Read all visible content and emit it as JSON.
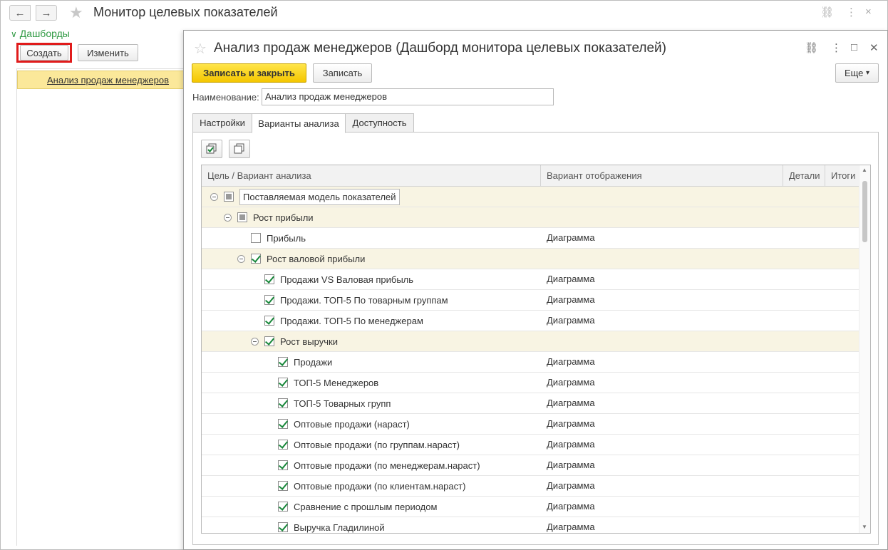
{
  "main": {
    "title": "Монитор целевых показателей",
    "back_icon": "←",
    "forward_icon": "→",
    "star_icon": "★",
    "link_icon": "⛓",
    "more_icon": "⋮",
    "close_icon": "×",
    "section_title": "Дашборды",
    "section_chevron": "∨",
    "create_label": "Создать",
    "edit_label": "Изменить",
    "list_items": [
      "Анализ продаж менеджеров"
    ]
  },
  "dialog": {
    "title": "Анализ продаж менеджеров (Дашборд монитора целевых показателей)",
    "star_icon": "☆",
    "link_icon": "⛓",
    "more_icon": "⋮",
    "maximize_icon": "□",
    "close_icon": "✕",
    "save_close_label": "Записать и закрыть",
    "save_label": "Записать",
    "more_label": "Еще",
    "more_arrow": "▾",
    "name_label": "Наименование:",
    "name_value": "Анализ продаж менеджеров",
    "tabs": [
      "Настройки",
      "Варианты анализа",
      "Доступность"
    ],
    "active_tab": 1,
    "columns": [
      "Цель / Вариант анализа",
      "Вариант отображения",
      "Детали",
      "Итоги"
    ],
    "rows": [
      {
        "name": "Поставляемая модель показателей",
        "view": "",
        "group": true,
        "level": 0,
        "check": "partial",
        "collapse": true,
        "boxed": true
      },
      {
        "name": "Рост прибыли",
        "view": "",
        "group": true,
        "level": 1,
        "check": "partial",
        "collapse": true
      },
      {
        "name": "Прибыль",
        "view": "Диаграмма",
        "group": false,
        "level": 2,
        "check": "none",
        "collapse": false
      },
      {
        "name": "Рост валовой прибыли",
        "view": "",
        "group": true,
        "level": 2,
        "check": "checked",
        "collapse": true
      },
      {
        "name": "Продажи VS Валовая прибыль",
        "view": "Диаграмма",
        "group": false,
        "level": 3,
        "check": "checked",
        "collapse": false
      },
      {
        "name": "Продажи. ТОП-5 По товарным группам",
        "view": "Диаграмма",
        "group": false,
        "level": 3,
        "check": "checked",
        "collapse": false
      },
      {
        "name": "Продажи. ТОП-5 По менеджерам",
        "view": "Диаграмма",
        "group": false,
        "level": 3,
        "check": "checked",
        "collapse": false
      },
      {
        "name": "Рост выручки",
        "view": "",
        "group": true,
        "level": 3,
        "check": "checked",
        "collapse": true
      },
      {
        "name": "Продажи",
        "view": "Диаграмма",
        "group": false,
        "level": 4,
        "check": "checked",
        "collapse": false
      },
      {
        "name": "ТОП-5 Менеджеров",
        "view": "Диаграмма",
        "group": false,
        "level": 4,
        "check": "checked",
        "collapse": false
      },
      {
        "name": "ТОП-5 Товарных групп",
        "view": "Диаграмма",
        "group": false,
        "level": 4,
        "check": "checked",
        "collapse": false
      },
      {
        "name": "Оптовые продажи (нараст)",
        "view": "Диаграмма",
        "group": false,
        "level": 4,
        "check": "checked",
        "collapse": false
      },
      {
        "name": "Оптовые продажи (по группам.нараст)",
        "view": "Диаграмма",
        "group": false,
        "level": 4,
        "check": "checked",
        "collapse": false
      },
      {
        "name": "Оптовые продажи (по менеджерам.нараст)",
        "view": "Диаграмма",
        "group": false,
        "level": 4,
        "check": "checked",
        "collapse": false
      },
      {
        "name": "Оптовые продажи (по клиентам.нараст)",
        "view": "Диаграмма",
        "group": false,
        "level": 4,
        "check": "checked",
        "collapse": false
      },
      {
        "name": "Сравнение с прошлым периодом",
        "view": "Диаграмма",
        "group": false,
        "level": 4,
        "check": "checked",
        "collapse": false
      },
      {
        "name": "Выручка Гладилиной",
        "view": "Диаграмма",
        "group": false,
        "level": 4,
        "check": "checked",
        "collapse": false
      }
    ]
  },
  "colors": {
    "accent_green": "#2f9a43",
    "highlight_red": "#e01b1b",
    "primary_yellow": "#f4c600",
    "selected_row": "#fbe89a",
    "group_row": "#f8f4e3"
  }
}
